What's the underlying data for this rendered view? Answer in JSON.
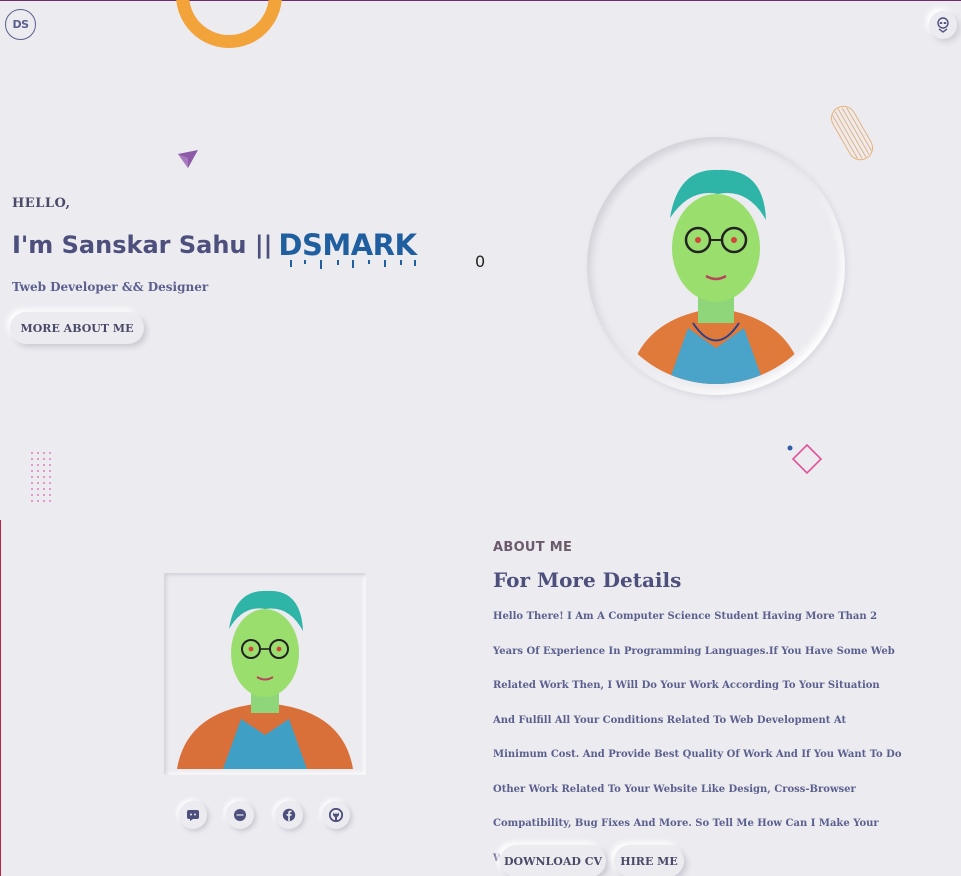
{
  "header": {
    "logo_text": "DS",
    "mascot_icon": "alien-icon"
  },
  "hero": {
    "greeting": "HELLO,",
    "name_prefix": "I'm Sanskar Sahu ||",
    "brand": "DSMARK",
    "counter": "0",
    "subtitle": "Tweb Developer && Designer",
    "more_button": "MORE ABOUT ME"
  },
  "about": {
    "label": "ABOUT ME",
    "heading": "For More Details",
    "body": "Hello There! I Am A Computer Science Student Having More Than 2 Years Of Experience In Programming Languages.If You Have Some Web Related Work Then, I Will Do Your Work According To Your Situation And Fulfill All Your Conditions Related To Web Development At Minimum Cost. And Provide Best Quality Of Work And If You Want To Do Other Work Related To Your Website Like Design, Cross-Browser Compatibility, Bug Fixes And More. So Tell Me How Can I Make Your Website Perfect.",
    "download_button": "DOWNLOAD CV",
    "hire_button": "HIRE ME",
    "socials": [
      "discord-icon",
      "messenger-icon",
      "facebook-icon",
      "github-icon"
    ]
  },
  "colors": {
    "background": "#ecebf0",
    "accent_orange": "#f2a33a",
    "brand_blue": "#1f5fa0",
    "text_primary": "#4d4f7c",
    "pink": "#e0559a"
  }
}
